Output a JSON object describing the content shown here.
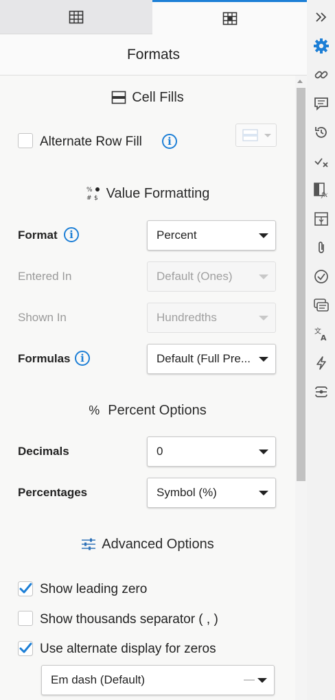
{
  "tabs": [
    {
      "icon": "grid-icon"
    },
    {
      "icon": "cell-format-icon",
      "active": true
    }
  ],
  "panel_title": "Formats",
  "cell_fills": {
    "heading": "Cell Fills",
    "alternate_row_fill": {
      "label": "Alternate Row Fill",
      "checked": false
    }
  },
  "value_formatting": {
    "heading": "Value Formatting",
    "format": {
      "label": "Format",
      "value": "Percent"
    },
    "entered_in": {
      "label": "Entered In",
      "value": "Default (Ones)",
      "disabled": true
    },
    "shown_in": {
      "label": "Shown In",
      "value": "Hundredths",
      "disabled": true
    },
    "formulas": {
      "label": "Formulas",
      "value": "Default (Full Pre..."
    }
  },
  "percent_options": {
    "heading_symbol": "%",
    "heading": "Percent Options",
    "decimals": {
      "label": "Decimals",
      "value": "0"
    },
    "percentages": {
      "label": "Percentages",
      "value": "Symbol (%)"
    }
  },
  "advanced_options": {
    "heading": "Advanced Options",
    "show_leading_zero": {
      "label": "Show leading zero",
      "checked": true
    },
    "show_thousands_separator": {
      "label": "Show thousands separator ( , )",
      "checked": false
    },
    "use_alternate_zeros": {
      "label": "Use alternate display for zeros",
      "checked": true
    },
    "zero_display": {
      "value": "Em dash (Default)",
      "preview": "—"
    }
  },
  "rail_icons": [
    "collapse-icon",
    "gear-icon",
    "link-icon",
    "comment-icon",
    "history-icon",
    "cell-history-icon",
    "formula-icon",
    "grid-select-icon",
    "attachment-icon",
    "check-circle-icon",
    "summary-icon",
    "translate-icon",
    "lightning-icon",
    "connector-icon"
  ],
  "colors": {
    "accent": "#1d7fd6",
    "panel": "#f8f8f7",
    "rail": "#f2f2f2"
  }
}
